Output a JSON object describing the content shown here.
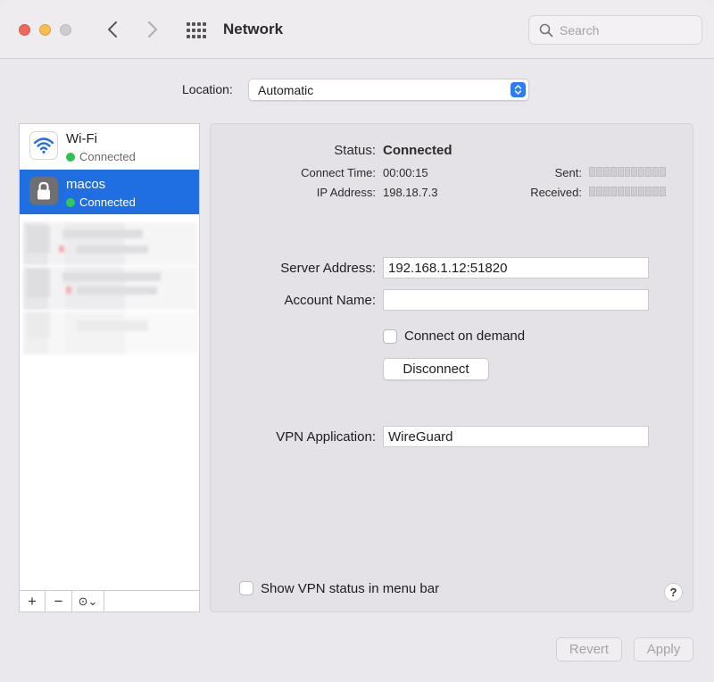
{
  "window": {
    "title": "Network",
    "search_placeholder": "Search"
  },
  "location": {
    "label": "Location:",
    "value": "Automatic"
  },
  "services": [
    {
      "name": "Wi-Fi",
      "status": "Connected",
      "icon": "wifi-icon",
      "status_color": "#30c14e"
    },
    {
      "name": "macos",
      "status": "Connected",
      "icon": "lock-icon",
      "status_color": "#34c759",
      "selected": true
    }
  ],
  "sidebar_toolbar": {
    "add": "+",
    "remove": "−",
    "more": "⊙⌄"
  },
  "detail": {
    "status_label": "Status:",
    "status_value": "Connected",
    "connect_time_label": "Connect Time:",
    "connect_time_value": "00:00:15",
    "ip_label": "IP Address:",
    "ip_value": "198.18.7.3",
    "sent_label": "Sent:",
    "received_label": "Received:",
    "server_address_label": "Server Address:",
    "server_address_value": "192.168.1.12:51820",
    "account_name_label": "Account Name:",
    "account_name_value": "",
    "connect_on_demand_label": "Connect on demand",
    "disconnect_label": "Disconnect",
    "vpn_application_label": "VPN Application:",
    "vpn_application_value": "WireGuard",
    "show_vpn_status_label": "Show VPN status in menu bar",
    "help_label": "?"
  },
  "footer": {
    "revert_label": "Revert",
    "apply_label": "Apply"
  },
  "colors": {
    "accent": "#1f6fe3",
    "status_green": "#30c14e"
  }
}
